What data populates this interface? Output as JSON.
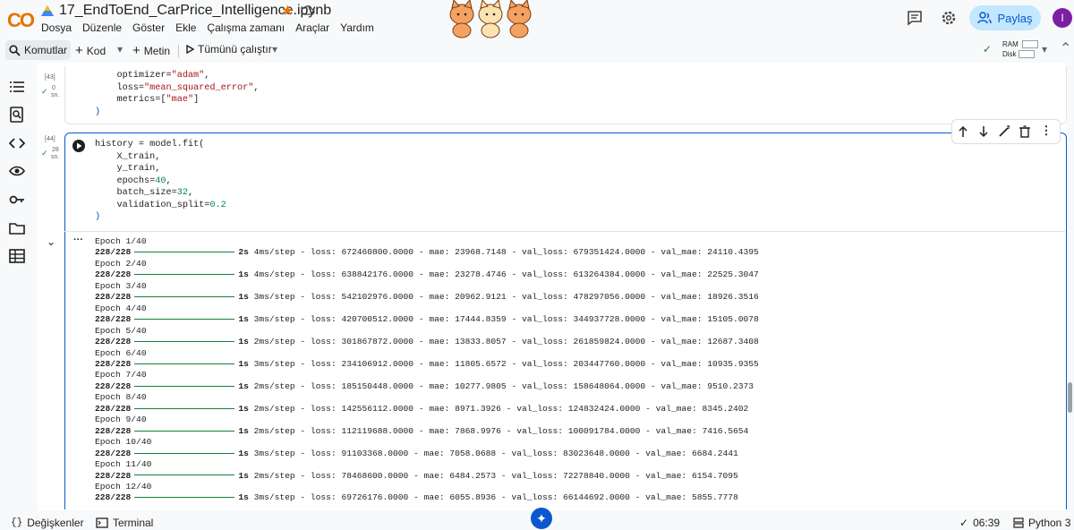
{
  "header": {
    "logo": "CO",
    "notebook_title": "17_EndToEnd_CarPrice_Intelligence.ipynb",
    "menu": [
      "Dosya",
      "Düzenle",
      "Göster",
      "Ekle",
      "Çalışma zamanı",
      "Araçlar",
      "Yardım"
    ],
    "share_label": "Paylaş",
    "avatar_initial": "I"
  },
  "toolbar": {
    "commands_label": "Komutlar",
    "add_code_label": "Kod",
    "add_text_label": "Metin",
    "run_all_label": "Tümünü çalıştır",
    "ram_label": "RAM",
    "disk_label": "Disk"
  },
  "cells": {
    "cell43": {
      "exec_count": "[43]",
      "exec_time_value": "0",
      "exec_time_unit": "sn.",
      "lines": [
        [
          "    optimizer=",
          "\"adam\"",
          ","
        ],
        [
          "    loss=",
          "\"mean_squared_error\"",
          ","
        ],
        [
          "    metrics=[",
          "\"mae\"",
          "]"
        ],
        [
          ")",
          "",
          ""
        ]
      ]
    },
    "cell44": {
      "exec_count": "[44]",
      "exec_time_value": "28",
      "exec_time_unit": "sn.",
      "line1": "history = model.fit(",
      "line2": "    X_train,",
      "line3": "    y_train,",
      "line4_prefix": "    epochs=",
      "line4_num": "40",
      "line5_prefix": "    batch_size=",
      "line5_num": "32",
      "line6_prefix": "    validation_split=",
      "line6_num": "0.2",
      "line7": ")"
    }
  },
  "output": {
    "epochs": [
      {
        "epoch": "Epoch 1/40",
        "steps": "228/228",
        "time": "2s",
        "rest": "4ms/step - loss: 672460800.0000 - mae: 23968.7148 - val_loss: 679351424.0000 - val_mae: 24110.4395"
      },
      {
        "epoch": "Epoch 2/40",
        "steps": "228/228",
        "time": "1s",
        "rest": "4ms/step - loss: 638842176.0000 - mae: 23278.4746 - val_loss: 613264384.0000 - val_mae: 22525.3047"
      },
      {
        "epoch": "Epoch 3/40",
        "steps": "228/228",
        "time": "1s",
        "rest": "3ms/step - loss: 542102976.0000 - mae: 20962.9121 - val_loss: 478297056.0000 - val_mae: 18926.3516"
      },
      {
        "epoch": "Epoch 4/40",
        "steps": "228/228",
        "time": "1s",
        "rest": "3ms/step - loss: 420700512.0000 - mae: 17444.8359 - val_loss: 344937728.0000 - val_mae: 15105.0078"
      },
      {
        "epoch": "Epoch 5/40",
        "steps": "228/228",
        "time": "1s",
        "rest": "2ms/step - loss: 301867872.0000 - mae: 13833.8057 - val_loss: 261859824.0000 - val_mae: 12687.3408"
      },
      {
        "epoch": "Epoch 6/40",
        "steps": "228/228",
        "time": "1s",
        "rest": "3ms/step - loss: 234106912.0000 - mae: 11805.6572 - val_loss: 203447760.0000 - val_mae: 10935.9355"
      },
      {
        "epoch": "Epoch 7/40",
        "steps": "228/228",
        "time": "1s",
        "rest": "2ms/step - loss: 185150448.0000 - mae: 10277.9805 - val_loss: 158648064.0000 - val_mae: 9510.2373"
      },
      {
        "epoch": "Epoch 8/40",
        "steps": "228/228",
        "time": "1s",
        "rest": "2ms/step - loss: 142556112.0000 - mae: 8971.3926 - val_loss: 124832424.0000 - val_mae: 8345.2402"
      },
      {
        "epoch": "Epoch 9/40",
        "steps": "228/228",
        "time": "1s",
        "rest": "2ms/step - loss: 112119688.0000 - mae: 7868.9976 - val_loss: 100091784.0000 - val_mae: 7416.5654"
      },
      {
        "epoch": "Epoch 10/40",
        "steps": "228/228",
        "time": "1s",
        "rest": "3ms/step - loss: 91103368.0000 - mae: 7058.0688 - val_loss: 83023648.0000 - val_mae: 6684.2441"
      },
      {
        "epoch": "Epoch 11/40",
        "steps": "228/228",
        "time": "1s",
        "rest": "2ms/step - loss: 78468600.0000 - mae: 6484.2573 - val_loss: 72278840.0000 - val_mae: 6154.7095"
      },
      {
        "epoch": "Epoch 12/40",
        "steps": "228/228",
        "time": "1s",
        "rest": "3ms/step - loss: 69726176.0000 - mae: 6055.8936 - val_loss: 66144692.0000 - val_mae: 5855.7778"
      }
    ]
  },
  "statusbar": {
    "variables_label": "Değişkenler",
    "terminal_label": "Terminal",
    "time": "06:39",
    "runtime": "Python 3"
  },
  "colors": {
    "accent": "#0b57d0",
    "share_bg": "#c2e7ff",
    "progress": "#188038",
    "avatar": "#7b1fa2"
  }
}
